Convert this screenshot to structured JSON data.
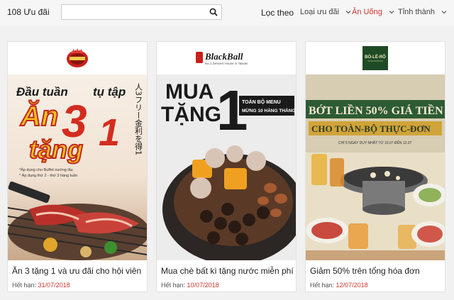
{
  "header": {
    "count_label": "108 Ưu đãi",
    "search_value": "",
    "filter_label": "Lọc theo",
    "filters": [
      {
        "label": "Loại ưu đãi",
        "active": false
      },
      {
        "label": "Ăn Uống",
        "active": true
      },
      {
        "label": "Tỉnh thành",
        "active": false
      }
    ]
  },
  "colors": {
    "accent": "#d0352b"
  },
  "cards": [
    {
      "brand_logo": "Sumo BBQ",
      "title": "Ăn 3 tặng 1 và ưu đãi cho hội viên",
      "expiry_label": "Hết hạn:",
      "expiry_date": "31/07/2018",
      "banner": {
        "line1": "Đầu tuần",
        "line2": "tụ tập",
        "big_left": "Ăn",
        "big_mid": "3",
        "big_right": "1",
        "line3": "tặng",
        "jp": "人3フリー金利を得1",
        "note1": "*Áp dụng cho Buffet nướng lẩu",
        "note2": "* Áp dụng thứ 2 - thứ 3 hàng tuần"
      }
    },
    {
      "brand_logo": "BlackBall",
      "brand_tagline": "No.1 Dessert House in Taiwan",
      "title": "Mua chè bất kì tặng nước miễn phí",
      "expiry_label": "Hết hạn:",
      "expiry_date": "10/07/2018",
      "banner": {
        "line1": "MUA",
        "line2": "TẶNG",
        "big": "1",
        "tag1": "TOÀN BỘ MENU",
        "tag2": "MỪNG 10 HÀNG THÁNG"
      }
    },
    {
      "brand_logo": "BÒ-LẾ-RÔ",
      "title": "Giảm 50% trên tổng hóa đơn",
      "expiry_label": "Hết hạn:",
      "expiry_date": "12/07/2018",
      "banner": {
        "line1": "BỚT LIỀN 50% GIÁ TIỀN",
        "line2": "CHO TOÀN-BỘ THỰC-ĐƠN",
        "sub": "CHỈ 5 NGÀY DUY NHẤT TỪ 10.07 ĐẾN 12.07"
      }
    }
  ]
}
